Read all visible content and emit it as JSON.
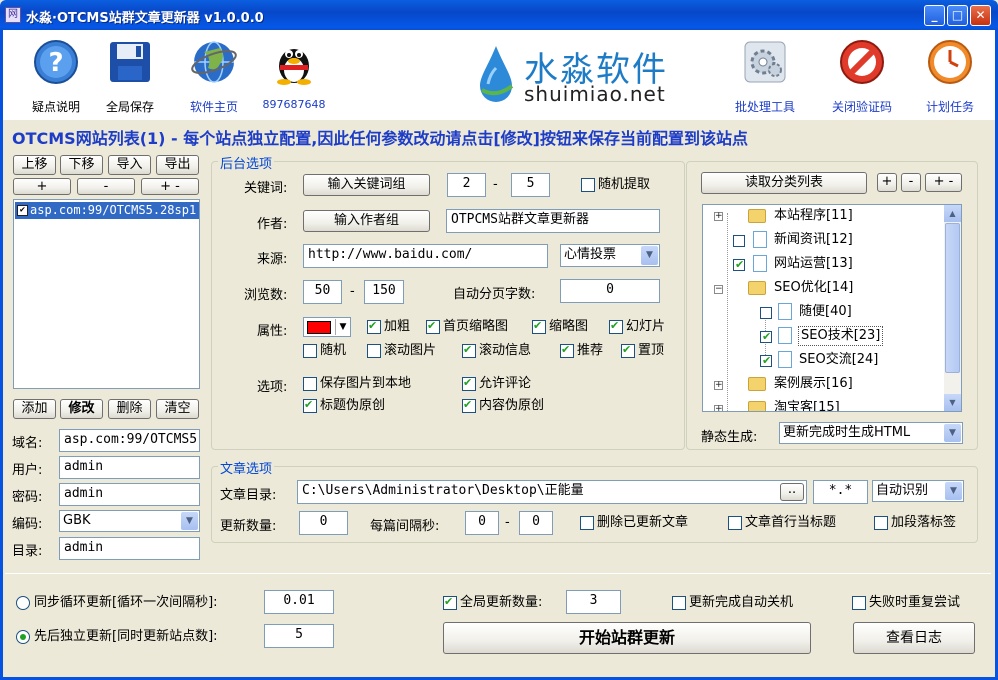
{
  "window": {
    "title": "水淼·OTCMS站群文章更新器 v1.0.0.0",
    "icon": "网"
  },
  "toolbar": {
    "help": "疑点说明",
    "save": "全局保存",
    "home": "软件主页",
    "qq": "897687648",
    "batch": "批处理工具",
    "captcha": "关闭验证码",
    "schedule": "计划任务"
  },
  "logo": {
    "cn": "水淼软件",
    "en": "shuimiao.net"
  },
  "banner": "OTCMS网站列表(1) - 每个站点独立配置,因此任何参数改动请点击[修改]按钮来保存当前配置到该站点",
  "sitelist": {
    "btn_up": "上移",
    "btn_down": "下移",
    "btn_import": "导入",
    "btn_export": "导出",
    "btn_plus": "+",
    "btn_minus": "-",
    "btn_pm": "+ -",
    "items": [
      "asp.com:99/OTCMS5.28sp1"
    ],
    "btn_add": "添加",
    "btn_edit": "修改",
    "btn_delete": "删除",
    "btn_clear": "清空",
    "domain_label": "域名:",
    "domain_value": "asp.com:99/OTCMS5",
    "user_label": "用户:",
    "user_value": "admin",
    "pass_label": "密码:",
    "pass_value": "admin",
    "enc_label": "编码:",
    "enc_value": "GBK",
    "dir_label": "目录:",
    "dir_value": "admin"
  },
  "backend": {
    "group_title": "后台选项",
    "kw_label": "关键词:",
    "kw_btn": "输入关键词组",
    "kw_min": "2",
    "dash": "-",
    "kw_max": "5",
    "kw_random": "随机提取",
    "author_label": "作者:",
    "author_btn": "输入作者组",
    "author_value": "OTPCMS站群文章更新器",
    "source_label": "来源:",
    "source_value": "http://www.baidu.com/",
    "vote_value": "心情投票",
    "views_label": "浏览数:",
    "views_min": "50",
    "views_max": "150",
    "paging_label": "自动分页字数:",
    "paging_value": "0",
    "attr_label": "属性:",
    "attr_bold": "加粗",
    "attr_home_thumb": "首页缩略图",
    "attr_thumb": "缩略图",
    "attr_slide": "幻灯片",
    "attr_random": "随机",
    "attr_scroll_img": "滚动图片",
    "attr_scroll_info": "滚动信息",
    "attr_recommend": "推荐",
    "attr_top": "置顶",
    "opt_label": "选项:",
    "opt_save_img": "保存图片到本地",
    "opt_allow_comment": "允许评论",
    "opt_fake_title": "标题伪原创",
    "opt_fake_content": "内容伪原创"
  },
  "category": {
    "read_btn": "读取分类列表",
    "plus": "+",
    "minus": "-",
    "pm": "+ -",
    "tree": [
      "本站程序[11]",
      "新闻资讯[12]",
      "网站运营[13]",
      "SEO优化[14]",
      "随便[40]",
      "SEO技术[23]",
      "SEO交流[24]",
      "案例展示[16]",
      "淘宝客[15]"
    ],
    "static_label": "静态生成:",
    "static_value": "更新完成时生成HTML"
  },
  "article": {
    "group_title": "文章选项",
    "dir_label": "文章目录:",
    "dir_value": "C:\\Users\\Administrator\\Desktop\\正能量",
    "browse": "..",
    "ext": "*.*",
    "encoding": "自动识别",
    "count_label": "更新数量:",
    "count_value": "0",
    "interval_label": "每篇间隔秒:",
    "interval_min": "0",
    "interval_max": "0",
    "del_updated": "删除已更新文章",
    "first_line_title": "文章首行当标题",
    "add_p_tag": "加段落标签"
  },
  "bottom": {
    "sync_label": "同步循环更新[循环一次间隔秒]:",
    "sync_value": "0.01",
    "seq_label": "先后独立更新[同时更新站点数]:",
    "seq_value": "5",
    "global_count_label": "全局更新数量:",
    "global_count_value": "3",
    "auto_shutdown": "更新完成自动关机",
    "retry": "失败时重复尝试",
    "start_btn": "开始站群更新",
    "log_btn": "查看日志"
  }
}
